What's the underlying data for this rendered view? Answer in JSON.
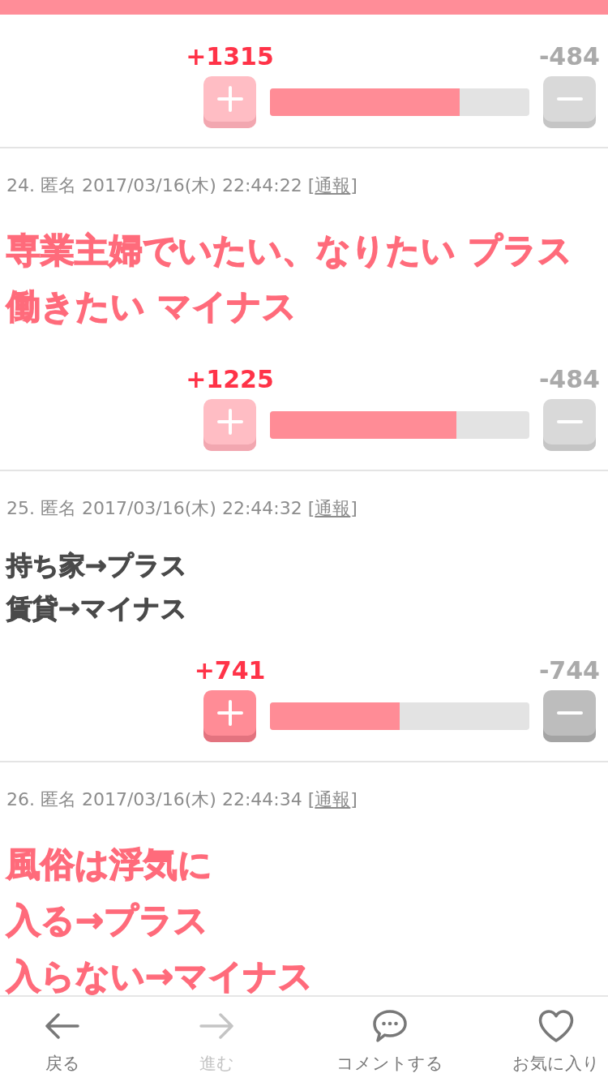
{
  "comments": [
    {
      "vote": {
        "plus": "+1315",
        "minus": "-484",
        "level": 0.73,
        "highlighted": false
      }
    },
    {
      "meta": "24. 匿名 2017/03/16(木) 22:44:22",
      "report": {
        "prefix": "[",
        "label": "通報",
        "suffix": "]"
      },
      "kind": "highlight",
      "lines": [
        "専業主婦でいたい、なりたい プラス",
        "働きたい マイナス"
      ],
      "vote": {
        "plus": "+1225",
        "minus": "-484",
        "level": 0.72,
        "highlighted": false
      }
    },
    {
      "meta": "25. 匿名 2017/03/16(木) 22:44:32",
      "report": {
        "prefix": "[",
        "label": "通報",
        "suffix": "]"
      },
      "kind": "plain",
      "lines": [
        "持ち家→プラス",
        "賃貸→マイナス"
      ],
      "vote": {
        "plus": "+741",
        "minus": "-744",
        "level": 0.5,
        "highlighted": true
      }
    },
    {
      "meta": "26. 匿名 2017/03/16(木) 22:44:34",
      "report": {
        "prefix": "[",
        "label": "通報",
        "suffix": "]"
      },
      "kind": "highlight",
      "lines": [
        "風俗は浮気に",
        "入る→プラス",
        "入らない→マイナス"
      ]
    }
  ],
  "bottom_nav": [
    {
      "kind": "back",
      "label": "戻る",
      "disabled": false
    },
    {
      "kind": "forward",
      "label": "進む",
      "disabled": true
    },
    {
      "kind": "comment",
      "label": "コメントする",
      "disabled": false
    },
    {
      "kind": "favorite",
      "label": "お気に入り",
      "disabled": false
    }
  ]
}
